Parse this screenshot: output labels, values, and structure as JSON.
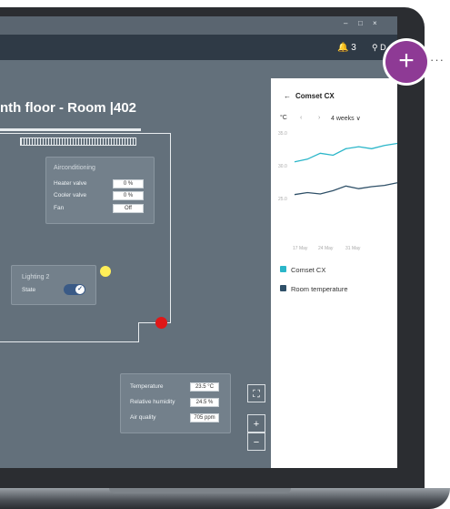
{
  "titlebar": {
    "minimize": "–",
    "maximize": "□",
    "close": "×"
  },
  "header": {
    "notifications_count": "3",
    "location_short": "D"
  },
  "room": {
    "title": "nth floor - Room |402"
  },
  "aircon": {
    "title": "Airconditioning",
    "rows": [
      {
        "label": "Heater valve",
        "value": "0 %"
      },
      {
        "label": "Cooler valve",
        "value": "0 %"
      },
      {
        "label": "Fan",
        "value": "Off"
      }
    ]
  },
  "lighting": {
    "title": "Lighting 2",
    "state_label": "State",
    "state_on": true
  },
  "sensors": {
    "rows": [
      {
        "label": "Temperature",
        "value": "23.5 °C"
      },
      {
        "label": "Relative humidity",
        "value": "24.5 %"
      },
      {
        "label": "Air quality",
        "value": "705 ppm"
      }
    ]
  },
  "map_controls": {
    "fullscreen": "⛶",
    "zoom_in": "+",
    "zoom_out": "−"
  },
  "detail_panel": {
    "back_arrow": "←",
    "title": "Comset CX",
    "unit": "°C",
    "prev": "‹",
    "next": "›",
    "range": "4 weeks ∨",
    "legend": [
      {
        "name": "Comset CX",
        "color": "#2bb6c9"
      },
      {
        "name": "Room temperature",
        "color": "#2f5068"
      }
    ]
  },
  "chart_data": {
    "type": "line",
    "x": [
      "17 May",
      "24 May",
      "31 May"
    ],
    "ylim": [
      25.0,
      35.0
    ],
    "yticks": [
      "35.0",
      "30.0",
      "25.0"
    ],
    "series": [
      {
        "name": "Comset CX",
        "values": [
          30.6,
          31.0,
          31.9,
          31.6,
          32.6,
          32.9,
          32.6,
          33.1,
          33.4
        ]
      },
      {
        "name": "Room temperature",
        "values": [
          25.6,
          25.9,
          25.7,
          26.2,
          26.9,
          26.5,
          26.8,
          27.0,
          27.4
        ]
      }
    ]
  },
  "colors": {
    "accent": "#8e3a95",
    "sensor_yellow": "#ffee58",
    "sensor_red": "#e01818"
  }
}
